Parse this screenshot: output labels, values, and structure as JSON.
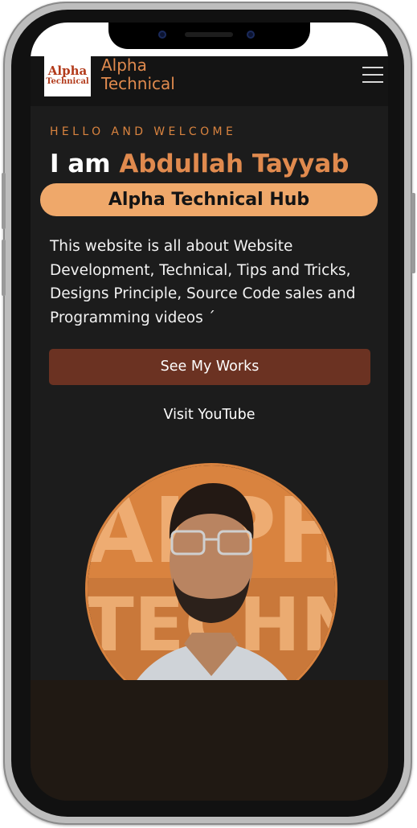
{
  "nav": {
    "logo_line1": "Alpha",
    "logo_line2": "Technical",
    "brand_line1": "Alpha",
    "brand_line2": "Technical",
    "menu_icon": "hamburger-menu-icon"
  },
  "hero": {
    "greeting": "HELLO AND WELCOME",
    "intro": "I am ",
    "name": "Abdullah Tayyab",
    "tagline": "Alpha Technical Hub",
    "description": "This website is all about Website Development, Technical, Tips and Tricks, Designs Principle, Source Code sales and Programming videos ´",
    "primary_button": "See My Works",
    "secondary_link": "Visit YouTube",
    "portrait_text": "ALPHA TECHNICAL"
  },
  "colors": {
    "accent": "#e08a4e",
    "pill": "#efa86a",
    "button": "#6b3222",
    "background": "#1c1c1c"
  }
}
